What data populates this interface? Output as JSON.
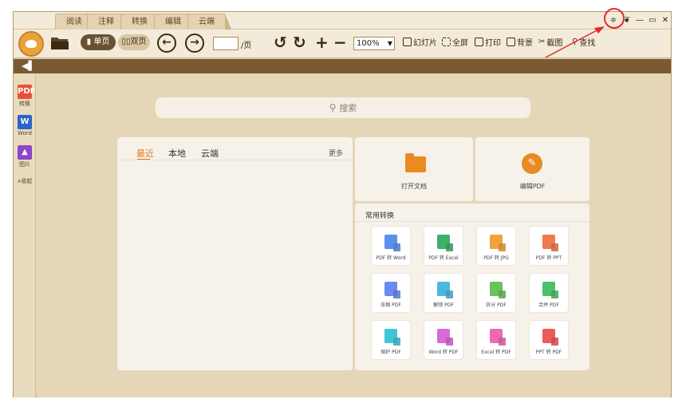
{
  "tabs": [
    "阅读",
    "注释",
    "转换",
    "编辑",
    "云端"
  ],
  "window_controls": {
    "skin": "❦",
    "minimize": "—",
    "maximize": "▭",
    "close": "✕",
    "dropdown": "≑"
  },
  "toolbar": {
    "single_page": "单页",
    "double_page": "双页",
    "back": "←",
    "forward": "→",
    "page_suffix": "/页",
    "rotate_left": "↺",
    "rotate_right": "↻",
    "zoom_in": "+",
    "zoom_out": "−",
    "zoom_value": "100%",
    "slideshow": "幻灯片",
    "fullscreen": "全屏",
    "print": "打印",
    "background": "背景",
    "screenshot": "截图",
    "find": "查找"
  },
  "sidebar": [
    {
      "label": "转换",
      "icon": "PDF",
      "color": "#e8523a"
    },
    {
      "label": "Word",
      "icon": "W",
      "color": "#2b63c8"
    },
    {
      "label": "图片",
      "icon": "▲",
      "color": "#8a45c9"
    }
  ],
  "sidebar_collapse": "∧收起",
  "search": {
    "placeholder": "搜索",
    "icon": "🔍"
  },
  "recent": {
    "tabs": [
      "最近",
      "本地",
      "云端"
    ],
    "more": "更多"
  },
  "actions": {
    "open_doc": "打开文档",
    "edit_pdf": "编辑PDF",
    "edit_icon": "✎"
  },
  "conversions": {
    "title": "常用转换",
    "items": [
      {
        "label": "PDF 转 Word",
        "color": "#5b8ff0"
      },
      {
        "label": "PDF 转 Excel",
        "color": "#3fb06a"
      },
      {
        "label": "PDF 转 JPG",
        "color": "#f0a440"
      },
      {
        "label": "PDF 转 PPT",
        "color": "#f07a4a"
      },
      {
        "label": "压缩 PDF",
        "color": "#6a8af0"
      },
      {
        "label": "解锁 PDF",
        "color": "#4ab8e0"
      },
      {
        "label": "拆分 PDF",
        "color": "#6ac25a"
      },
      {
        "label": "合并 PDF",
        "color": "#4cc06a"
      },
      {
        "label": "保护 PDF",
        "color": "#3ec6d8"
      },
      {
        "label": "Word 转 PDF",
        "color": "#d96ad8"
      },
      {
        "label": "Excel 转 PDF",
        "color": "#ee6ab0"
      },
      {
        "label": "PPT 转 PDF",
        "color": "#ee5a5a"
      }
    ]
  }
}
